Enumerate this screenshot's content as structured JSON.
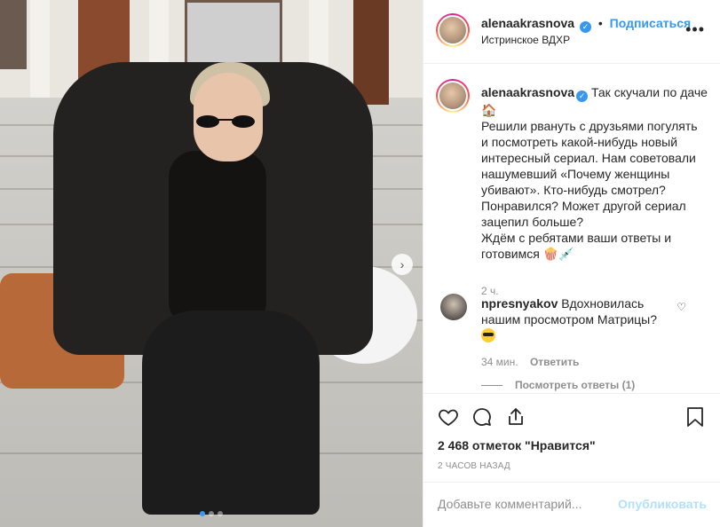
{
  "header": {
    "username": "alenaakrasnova",
    "separator": "•",
    "follow_label": "Подписаться",
    "location": "Истринское ВДХР",
    "more_icon": "more-horizontal-icon"
  },
  "caption": {
    "username": "alenaakrasnova",
    "text": "Так скучали по даче 🏠\nРешили рвануть с друзьями погулять и посмотреть какой-нибудь новый интересный сериал. Нам советовали нашумевший «Почему женщины убивают». Кто-нибудь смотрел? Понравился? Может другой сериал зацепил больше?\nЖдём с ребятами ваши ответы и готовимся 🍿💉",
    "time": "2 ч."
  },
  "comment": {
    "username": "npresnyakov",
    "text": "Вдохновилась нашим просмотром Матрицы?",
    "emoji": "😎",
    "time": "34 мин.",
    "reply_label": "Ответить",
    "view_replies": "Посмотреть ответы (1)"
  },
  "actions": {
    "likes": "2 468 отметок \"Нравится\"",
    "posted": "2 ЧАСОВ НАЗАД"
  },
  "add_comment": {
    "placeholder": "Добавьте комментарий...",
    "publish_label": "Опубликовать"
  },
  "carousel": {
    "slides": 3,
    "active_index": 0
  },
  "colors": {
    "accent": "#3897f0",
    "publish_disabled": "#b2dffc",
    "muted_text": "#8e8e8e"
  }
}
